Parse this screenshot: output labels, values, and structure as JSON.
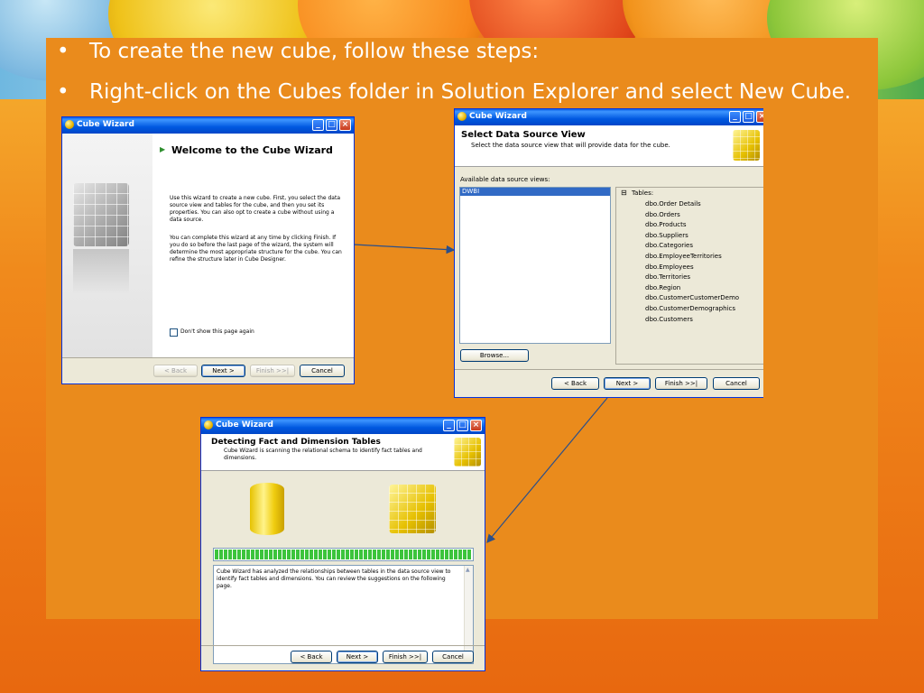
{
  "slide": {
    "bullets": [
      {
        "marker": "•",
        "text": "To create the new cube, follow these steps:"
      },
      {
        "marker": "•",
        "text": "Right-click on the Cubes folder in Solution Explorer and select New Cube."
      }
    ]
  },
  "wizard1": {
    "title": "Cube Wizard",
    "heading": "Welcome to the Cube Wizard",
    "para1": "Use this wizard to create a new cube. First, you select the data source view and tables for the cube, and then you set its properties. You can also opt to create a cube without using a data source.",
    "para2": "You can complete this wizard at any time by clicking Finish. If you do so before the last page of the wizard, the system will determine the most appropriate structure for the cube. You can refine the structure later in Cube Designer.",
    "checkbox_label": "Don't show this page again",
    "buttons": {
      "back": "< Back",
      "next": "Next >",
      "finish": "Finish >>|",
      "cancel": "Cancel"
    }
  },
  "wizard2": {
    "title": "Cube Wizard",
    "header_title": "Select Data Source View",
    "header_desc": "Select the data source view that will provide data for the cube.",
    "list_label": "Available data source views:",
    "list_items": [
      "DWBI"
    ],
    "tree_root": "Tables:",
    "tree_toggle": "⊟",
    "tables": [
      "dbo.Order Details",
      "dbo.Orders",
      "dbo.Products",
      "dbo.Suppliers",
      "dbo.Categories",
      "dbo.EmployeeTerritories",
      "dbo.Employees",
      "dbo.Territories",
      "dbo.Region",
      "dbo.CustomerCustomerDemo",
      "dbo.CustomerDemographics",
      "dbo.Customers"
    ],
    "browse": "Browse...",
    "buttons": {
      "back": "< Back",
      "next": "Next >",
      "finish": "Finish >>|",
      "cancel": "Cancel"
    }
  },
  "wizard3": {
    "title": "Cube Wizard",
    "header_title": "Detecting Fact and Dimension Tables",
    "header_desc": "Cube Wizard is scanning the relational schema to identify fact tables and dimensions.",
    "progress": 1.0,
    "status_text": "Cube Wizard has analyzed the relationships between tables in the data source view to identify fact tables and dimensions. You can review the suggestions on the following page.",
    "buttons": {
      "back": "< Back",
      "next": "Next >",
      "finish": "Finish >>|",
      "cancel": "Cancel"
    }
  },
  "colors": {
    "accent": "#ea8b1c",
    "title_bar": "#0058e0",
    "progress": "#3cc43c",
    "selection": "#316ac5"
  },
  "icons": {
    "window": "cube-wizard-icon",
    "minimize": "minimize-icon",
    "maximize": "maximize-icon",
    "close": "close-icon"
  }
}
